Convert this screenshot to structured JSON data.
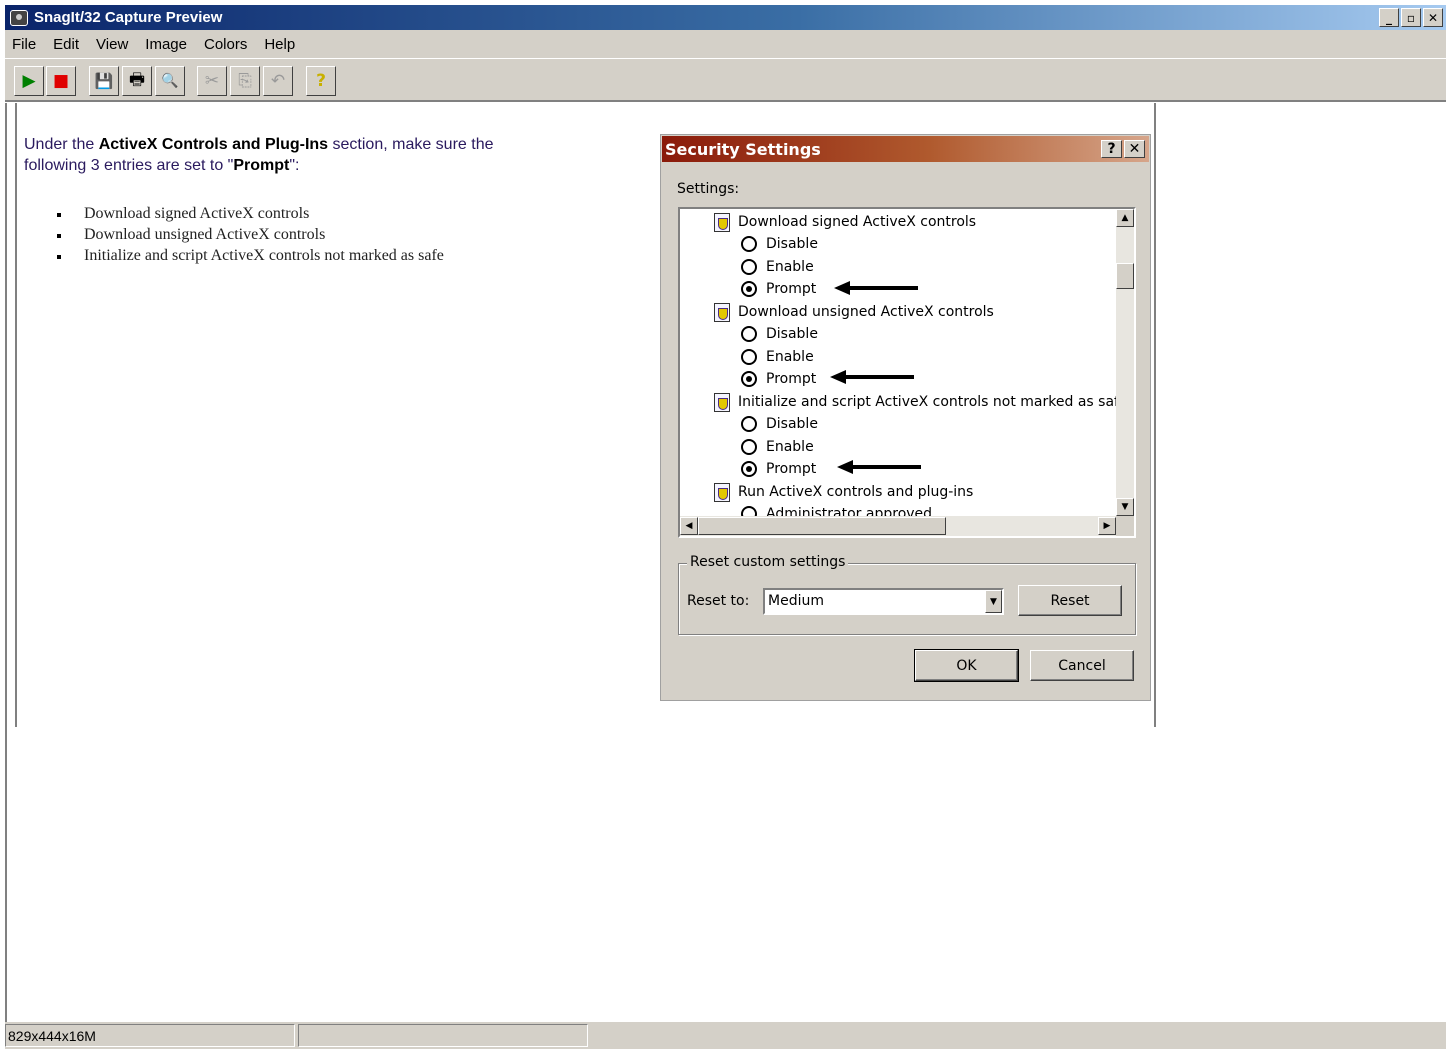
{
  "window": {
    "title": "SnagIt/32 Capture Preview",
    "controls": {
      "minimize": "_",
      "restore": "▫",
      "close": "✕"
    }
  },
  "menu": [
    "File",
    "Edit",
    "View",
    "Image",
    "Colors",
    "Help"
  ],
  "toolbar": {
    "buttons": [
      {
        "name": "play-button",
        "icon": "play-icon",
        "glyph": "▶",
        "enabled": true
      },
      {
        "name": "stop-button",
        "icon": "stop-icon",
        "glyph": "■",
        "enabled": true
      },
      {
        "name": "save-button",
        "icon": "floppy-disk-icon",
        "glyph": "💾",
        "enabled": true
      },
      {
        "name": "print-button",
        "icon": "printer-icon",
        "glyph": "🖶",
        "enabled": true
      },
      {
        "name": "print-preview-button",
        "icon": "print-preview-icon",
        "glyph": "🔍",
        "enabled": true
      },
      {
        "name": "cut-button",
        "icon": "scissors-icon",
        "glyph": "✂",
        "enabled": false
      },
      {
        "name": "copy-button",
        "icon": "copy-icon",
        "glyph": "⎘",
        "enabled": false
      },
      {
        "name": "undo-button",
        "icon": "undo-icon",
        "glyph": "↶",
        "enabled": false
      },
      {
        "name": "help-button",
        "icon": "help-icon",
        "glyph": "?",
        "enabled": true
      }
    ],
    "colors": {
      "play": "#008000",
      "stop": "#e00000",
      "help": "#c8b000"
    }
  },
  "instructions": {
    "part1": "Under the ",
    "bold1": "ActiveX Controls and Plug-Ins",
    "part2": " section, make sure the following 3 entries are set to \"",
    "bold2": "Prompt",
    "part3": "\":",
    "bullets": [
      "Download signed ActiveX controls",
      "Download unsigned ActiveX controls",
      "Initialize and script ActiveX controls not marked as safe"
    ]
  },
  "dialog": {
    "title": "Security Settings",
    "help_glyph": "?",
    "close_glyph": "✕",
    "settings_label": "Settings:",
    "items": [
      {
        "label": "Download signed ActiveX controls",
        "options": [
          "Disable",
          "Enable",
          "Prompt"
        ],
        "selected": 2
      },
      {
        "label": "Download unsigned ActiveX controls",
        "options": [
          "Disable",
          "Enable",
          "Prompt"
        ],
        "selected": 2
      },
      {
        "label": "Initialize and script ActiveX controls not marked as safe",
        "options": [
          "Disable",
          "Enable",
          "Prompt"
        ],
        "selected": 2
      },
      {
        "label": "Run ActiveX controls and plug-ins",
        "options": [
          "Administrator approved"
        ],
        "selected": -1
      }
    ],
    "scroll_glyphs": {
      "up": "▲",
      "down": "▼",
      "left": "◀",
      "right": "▶"
    },
    "reset_group": {
      "legend": "Reset custom settings",
      "reset_to_label": "Reset to:",
      "selected_level": "Medium",
      "dropdown_glyph": "▼",
      "reset_button": "Reset"
    },
    "ok_button": "OK",
    "cancel_button": "Cancel"
  },
  "status": {
    "pane1": "829x444x16M",
    "pane2": ""
  }
}
